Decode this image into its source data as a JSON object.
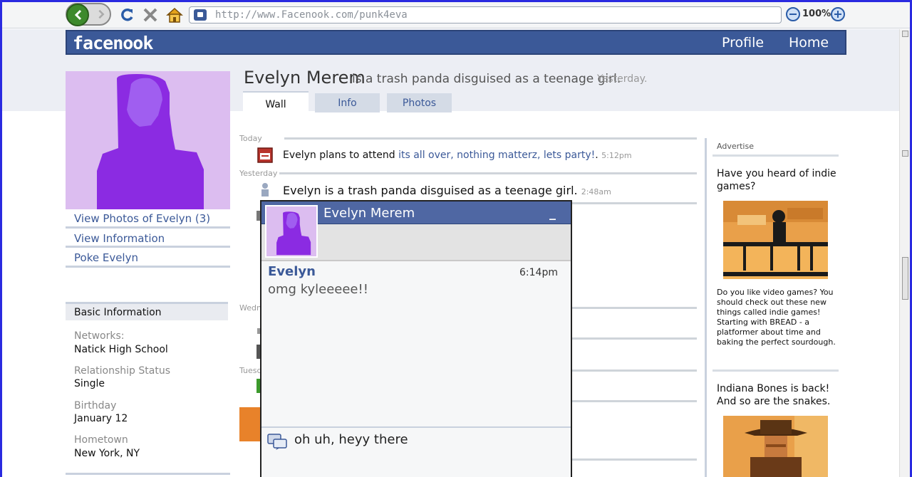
{
  "browser": {
    "url": "http://www.Facenook.com/punk4eva",
    "zoom": "100%"
  },
  "header": {
    "logo": "facenook",
    "nav": [
      "Profile",
      "Home"
    ]
  },
  "profile": {
    "name": "Evelyn Merem",
    "status": "is a trash panda disguised as a teenage girl.",
    "status_time": "Yesterday.",
    "tabs": [
      "Wall",
      "Info",
      "Photos"
    ],
    "active_tab": "Wall"
  },
  "sidebar": {
    "links": [
      "View Photos of Evelyn (3)",
      "View Information",
      "Poke Evelyn"
    ],
    "basic_info_title": "Basic Information",
    "fields": [
      {
        "label": "Networks:",
        "value": "Natick High School"
      },
      {
        "label": "Relationship Status",
        "value": "Single"
      },
      {
        "label": "Birthday",
        "value": "January 12"
      },
      {
        "label": "Hometown",
        "value": "New York, NY"
      }
    ]
  },
  "wall": {
    "dates": [
      "Today",
      "Yesterday",
      "Wedn",
      "Tuesd"
    ],
    "posts": [
      {
        "icon": "calendar-icon",
        "prefix": "Evelyn plans to attend ",
        "link": "its all over, nothing matterz, lets party!",
        "suffix": ".",
        "time": "5:12pm"
      },
      {
        "icon": "person-icon",
        "text": "Evelyn is a trash panda disguised as a teenage girl.",
        "time": "2:48am"
      }
    ]
  },
  "ads": {
    "label": "Advertise",
    "items": [
      {
        "title": "Have you heard of indie games?",
        "body": "Do you like video games? You should check out these new things called indie games! Starting with BREAD - a platformer about time and baking the perfect sourdough."
      },
      {
        "title": "Indiana Bones is back! And so are the snakes."
      }
    ]
  },
  "chat": {
    "title": "Evelyn Merem",
    "minimize": "_",
    "sender": "Evelyn",
    "time": "6:14pm",
    "message": "omg kyleeeee!!",
    "input": "oh uh, heyy there"
  },
  "colors": {
    "brand": "#3b5998",
    "chat_header": "#4f67a3",
    "avatar_bg": "#dcbdf0",
    "avatar_figure": "#8b2be2"
  }
}
